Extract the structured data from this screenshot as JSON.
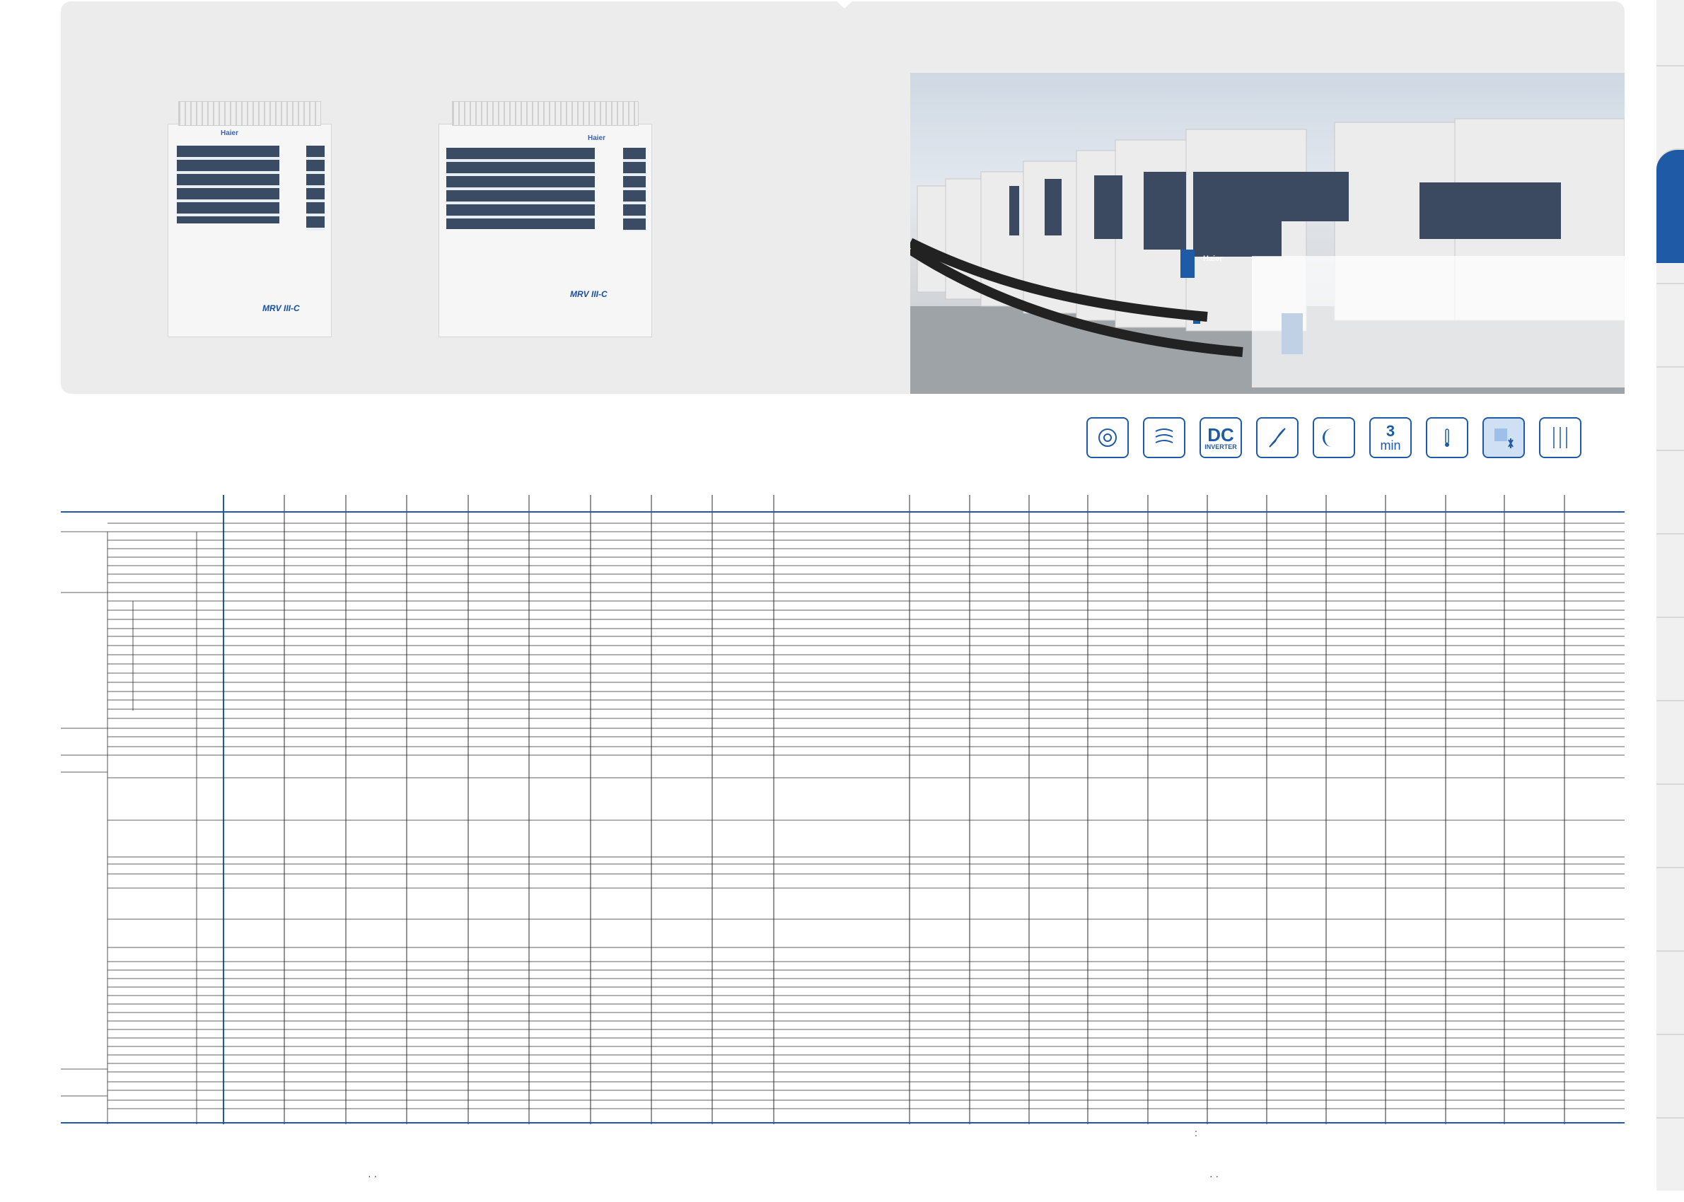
{
  "products": [
    {
      "brand_label": "Haier",
      "model_badge": "MRV III-C"
    },
    {
      "brand_label": "Haier",
      "model_badge": "MRV III-C"
    }
  ],
  "photo": {
    "unit_brand_label": "Haier"
  },
  "feature_icons": [
    {
      "name": "turbo-fan-icon",
      "label": ""
    },
    {
      "name": "anti-corrosion-coil-icon",
      "label": ""
    },
    {
      "name": "dc-inverter-icon",
      "label": "DC",
      "sublabel": "INVERTER"
    },
    {
      "name": "feather-quiet-icon",
      "label": ""
    },
    {
      "name": "night-mode-moon-icon",
      "label": ""
    },
    {
      "name": "three-minute-protection-icon",
      "label": "3",
      "sublabel": "min"
    },
    {
      "name": "thermometer-icon",
      "label": ""
    },
    {
      "name": "defrost-icon",
      "label": ""
    },
    {
      "name": "refrigerant-piping-icon",
      "label": ""
    }
  ],
  "colors": {
    "accent": "#1e5aa6",
    "table_lines": "#2b2b2b",
    "panel": "#ececec"
  },
  "footnotes": {
    "right_colon": ":",
    "left_dots": "· ·",
    "right_dots": "· ·"
  }
}
